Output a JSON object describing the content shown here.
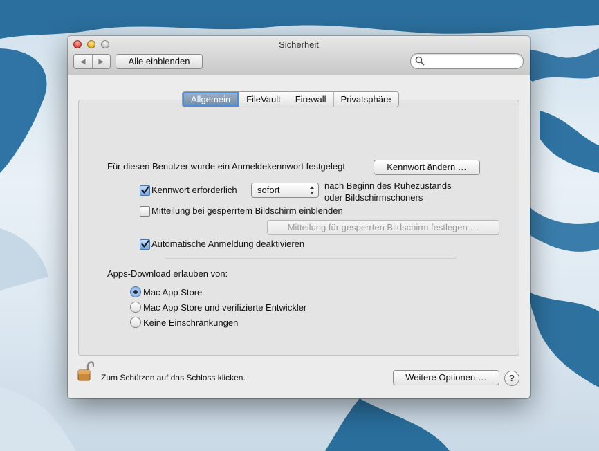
{
  "window": {
    "title": "Sicherheit"
  },
  "toolbar": {
    "show_all_label": "Alle einblenden",
    "search_placeholder": ""
  },
  "tabs": [
    {
      "label": "Allgemein",
      "active": true
    },
    {
      "label": "FileVault",
      "active": false
    },
    {
      "label": "Firewall",
      "active": false
    },
    {
      "label": "Privatsphäre",
      "active": false
    }
  ],
  "general": {
    "password_set_text": "Für diesen Benutzer wurde ein Anmeldekennwort festgelegt",
    "change_password_button": "Kennwort ändern …",
    "require_password": {
      "label": "Kennwort erforderlich",
      "checked": true
    },
    "require_select_value": "sofort",
    "require_after_line1": "nach Beginn des Ruhezustands",
    "require_after_line2": "oder Bildschirmschoners",
    "show_message": {
      "label": "Mitteilung bei gesperrtem Bildschirm einblenden",
      "checked": false
    },
    "set_message_button": "Mitteilung für gesperrten Bildschirm festlegen …",
    "disable_auto_login": {
      "label": "Automatische Anmeldung deaktivieren",
      "checked": true
    },
    "apps_download_label": "Apps-Download erlauben von:",
    "radio_options": [
      {
        "label": "Mac App Store",
        "selected": true
      },
      {
        "label": "Mac App Store und verifizierte Entwickler",
        "selected": false
      },
      {
        "label": "Keine Einschränkungen",
        "selected": false
      }
    ]
  },
  "footer": {
    "lock_text": "Zum Schützen auf das Schloss klicken.",
    "advanced_button": "Weitere Optionen …",
    "help_label": "?"
  },
  "icons": {
    "back": "back-arrow-icon",
    "forward": "forward-arrow-icon",
    "search": "search-icon",
    "lock": "lock-open-icon",
    "help": "help-icon"
  },
  "colors": {
    "accent": "#4d8ee0",
    "selected_tab": "#7d96b2",
    "window_bg": "#ececec"
  }
}
